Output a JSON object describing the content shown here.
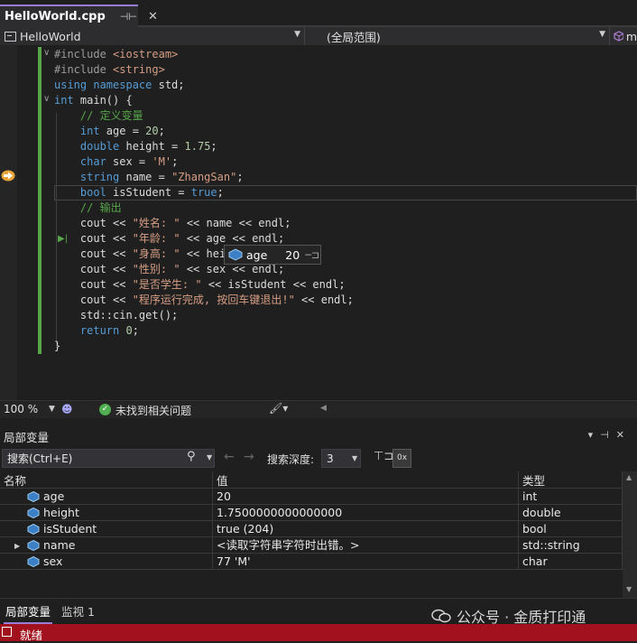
{
  "tab": {
    "file_name": "HelloWorld.cpp",
    "pin_icon": "pin-icon",
    "close_icon": "close-icon"
  },
  "navbar": {
    "project": "HelloWorld",
    "scope": "(全局范围)",
    "member": "m"
  },
  "editor": {
    "lines": [
      {
        "parts": [
          {
            "c": "pp",
            "t": "#include "
          },
          {
            "c": "str",
            "t": "<iostream>"
          }
        ]
      },
      {
        "parts": [
          {
            "c": "pp",
            "t": "#include "
          },
          {
            "c": "str",
            "t": "<string>"
          }
        ]
      },
      {
        "parts": [
          {
            "c": "kw",
            "t": "using namespace "
          },
          {
            "c": "tx",
            "t": "std;"
          }
        ]
      },
      {
        "parts": [
          {
            "c": "kw",
            "t": "int "
          },
          {
            "c": "tx",
            "t": "main() {"
          }
        ]
      },
      {
        "parts": [
          {
            "c": "com",
            "t": "    // 定义变量"
          }
        ]
      },
      {
        "parts": [
          {
            "c": "kw",
            "t": "    int "
          },
          {
            "c": "tx",
            "t": "age = "
          },
          {
            "c": "num",
            "t": "20"
          },
          {
            "c": "tx",
            "t": ";"
          }
        ]
      },
      {
        "parts": [
          {
            "c": "kw",
            "t": "    double "
          },
          {
            "c": "tx",
            "t": "height = "
          },
          {
            "c": "num",
            "t": "1.75"
          },
          {
            "c": "tx",
            "t": ";"
          }
        ]
      },
      {
        "parts": [
          {
            "c": "kw",
            "t": "    char "
          },
          {
            "c": "tx",
            "t": "sex = "
          },
          {
            "c": "str",
            "t": "'M'"
          },
          {
            "c": "tx",
            "t": ";"
          }
        ]
      },
      {
        "parts": [
          {
            "c": "kw",
            "t": "    string "
          },
          {
            "c": "tx",
            "t": "name = "
          },
          {
            "c": "str",
            "t": "\"ZhangSan\""
          },
          {
            "c": "tx",
            "t": ";"
          }
        ]
      },
      {
        "parts": [
          {
            "c": "kw",
            "t": "    bool "
          },
          {
            "c": "tx",
            "t": "isStudent = "
          },
          {
            "c": "kw",
            "t": "true"
          },
          {
            "c": "tx",
            "t": ";"
          }
        ]
      },
      {
        "parts": [
          {
            "c": "com",
            "t": "    // 输出"
          }
        ]
      },
      {
        "parts": [
          {
            "c": "tx",
            "t": "    cout << "
          },
          {
            "c": "str",
            "t": "\"姓名: \""
          },
          {
            "c": "tx",
            "t": " << name << endl;"
          }
        ]
      },
      {
        "parts": [
          {
            "c": "tx",
            "t": "    cout << "
          },
          {
            "c": "str",
            "t": "\"年龄: \""
          },
          {
            "c": "tx",
            "t": " << age << endl;"
          }
        ]
      },
      {
        "parts": [
          {
            "c": "tx",
            "t": "    cout << "
          },
          {
            "c": "str",
            "t": "\"身高: \""
          },
          {
            "c": "tx",
            "t": " << height << endl;"
          }
        ]
      },
      {
        "parts": [
          {
            "c": "tx",
            "t": "    cout << "
          },
          {
            "c": "str",
            "t": "\"性别: \""
          },
          {
            "c": "tx",
            "t": " << sex << endl;"
          }
        ]
      },
      {
        "parts": [
          {
            "c": "tx",
            "t": "    cout << "
          },
          {
            "c": "str",
            "t": "\"是否学生: \""
          },
          {
            "c": "tx",
            "t": " << isStudent << endl;"
          }
        ]
      },
      {
        "parts": [
          {
            "c": "tx",
            "t": "    cout << "
          },
          {
            "c": "str",
            "t": "\"程序运行完成, 按回车键退出!\""
          },
          {
            "c": "tx",
            "t": " << endl;"
          }
        ]
      },
      {
        "parts": [
          {
            "c": "tx",
            "t": "    std::cin.get();"
          }
        ]
      },
      {
        "parts": [
          {
            "c": "kw",
            "t": "    return "
          },
          {
            "c": "num",
            "t": "0"
          },
          {
            "c": "tx",
            "t": ";"
          }
        ]
      },
      {
        "parts": [
          {
            "c": "tx",
            "t": "}"
          }
        ]
      }
    ],
    "datatip": {
      "name": "age",
      "value": "20"
    }
  },
  "editor_status": {
    "zoom": "100 %",
    "issues": "未找到相关问题"
  },
  "locals_panel": {
    "title": "局部变量",
    "search_placeholder": "搜索(Ctrl+E)",
    "depth_label": "搜索深度:",
    "depth_value": "3",
    "hex_label": "0x",
    "columns": {
      "name": "名称",
      "value": "值",
      "type": "类型"
    },
    "rows": [
      {
        "name": "age",
        "value": "20",
        "type": "int",
        "expandable": false
      },
      {
        "name": "height",
        "value": "1.7500000000000000",
        "type": "double",
        "expandable": false
      },
      {
        "name": "isStudent",
        "value": "true (204)",
        "type": "bool",
        "expandable": false
      },
      {
        "name": "name",
        "value": "<读取字符串字符时出错。>",
        "type": "std::string",
        "expandable": true
      },
      {
        "name": "sex",
        "value": "77 'M'",
        "type": "char",
        "expandable": false
      }
    ]
  },
  "bottom_tabs": {
    "locals": "局部变量",
    "watch": "监视 1"
  },
  "watermark": "公众号 · 金质打印通",
  "statusbar": {
    "text": "就绪",
    "color": "#a1111e"
  },
  "colors": {
    "keyword": "#569cd6",
    "string": "#d69d85",
    "comment": "#57a64a",
    "accent": "#9b7cd4"
  }
}
